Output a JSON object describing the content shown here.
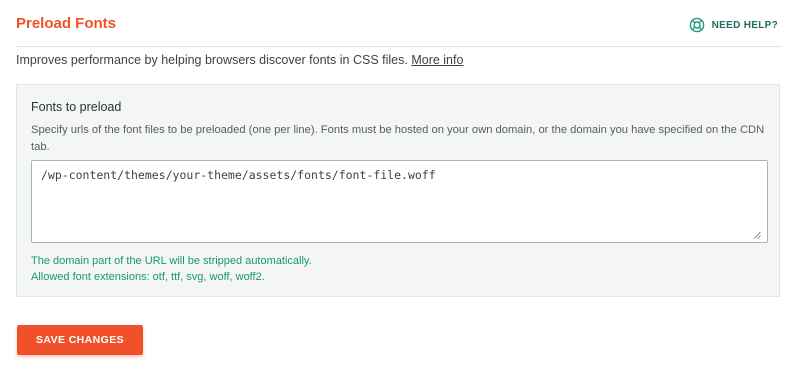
{
  "header": {
    "title": "Preload Fonts",
    "help_label": "NEED HELP?"
  },
  "description": {
    "text": "Improves performance by helping browsers discover fonts in CSS files.",
    "link_label": "More info"
  },
  "panel": {
    "field_label": "Fonts to preload",
    "field_help": "Specify urls of the font files to be preloaded (one per line). Fonts must be hosted on your own domain, or the domain you have specified on the CDN tab.",
    "textarea_value": "/wp-content/themes/your-theme/assets/fonts/font-file.woff",
    "note_1": "The domain part of the URL will be stripped automatically.",
    "note_2": "Allowed font extensions: otf, ttf, svg, woff, woff2."
  },
  "actions": {
    "save_label": "SAVE CHANGES"
  },
  "colors": {
    "accent": "#f0512a",
    "help_teal": "#1f6d5e",
    "note_green": "#1a9a62"
  },
  "icons": {
    "help": "lifebuoy-icon",
    "resize": "resize-handle-icon"
  }
}
